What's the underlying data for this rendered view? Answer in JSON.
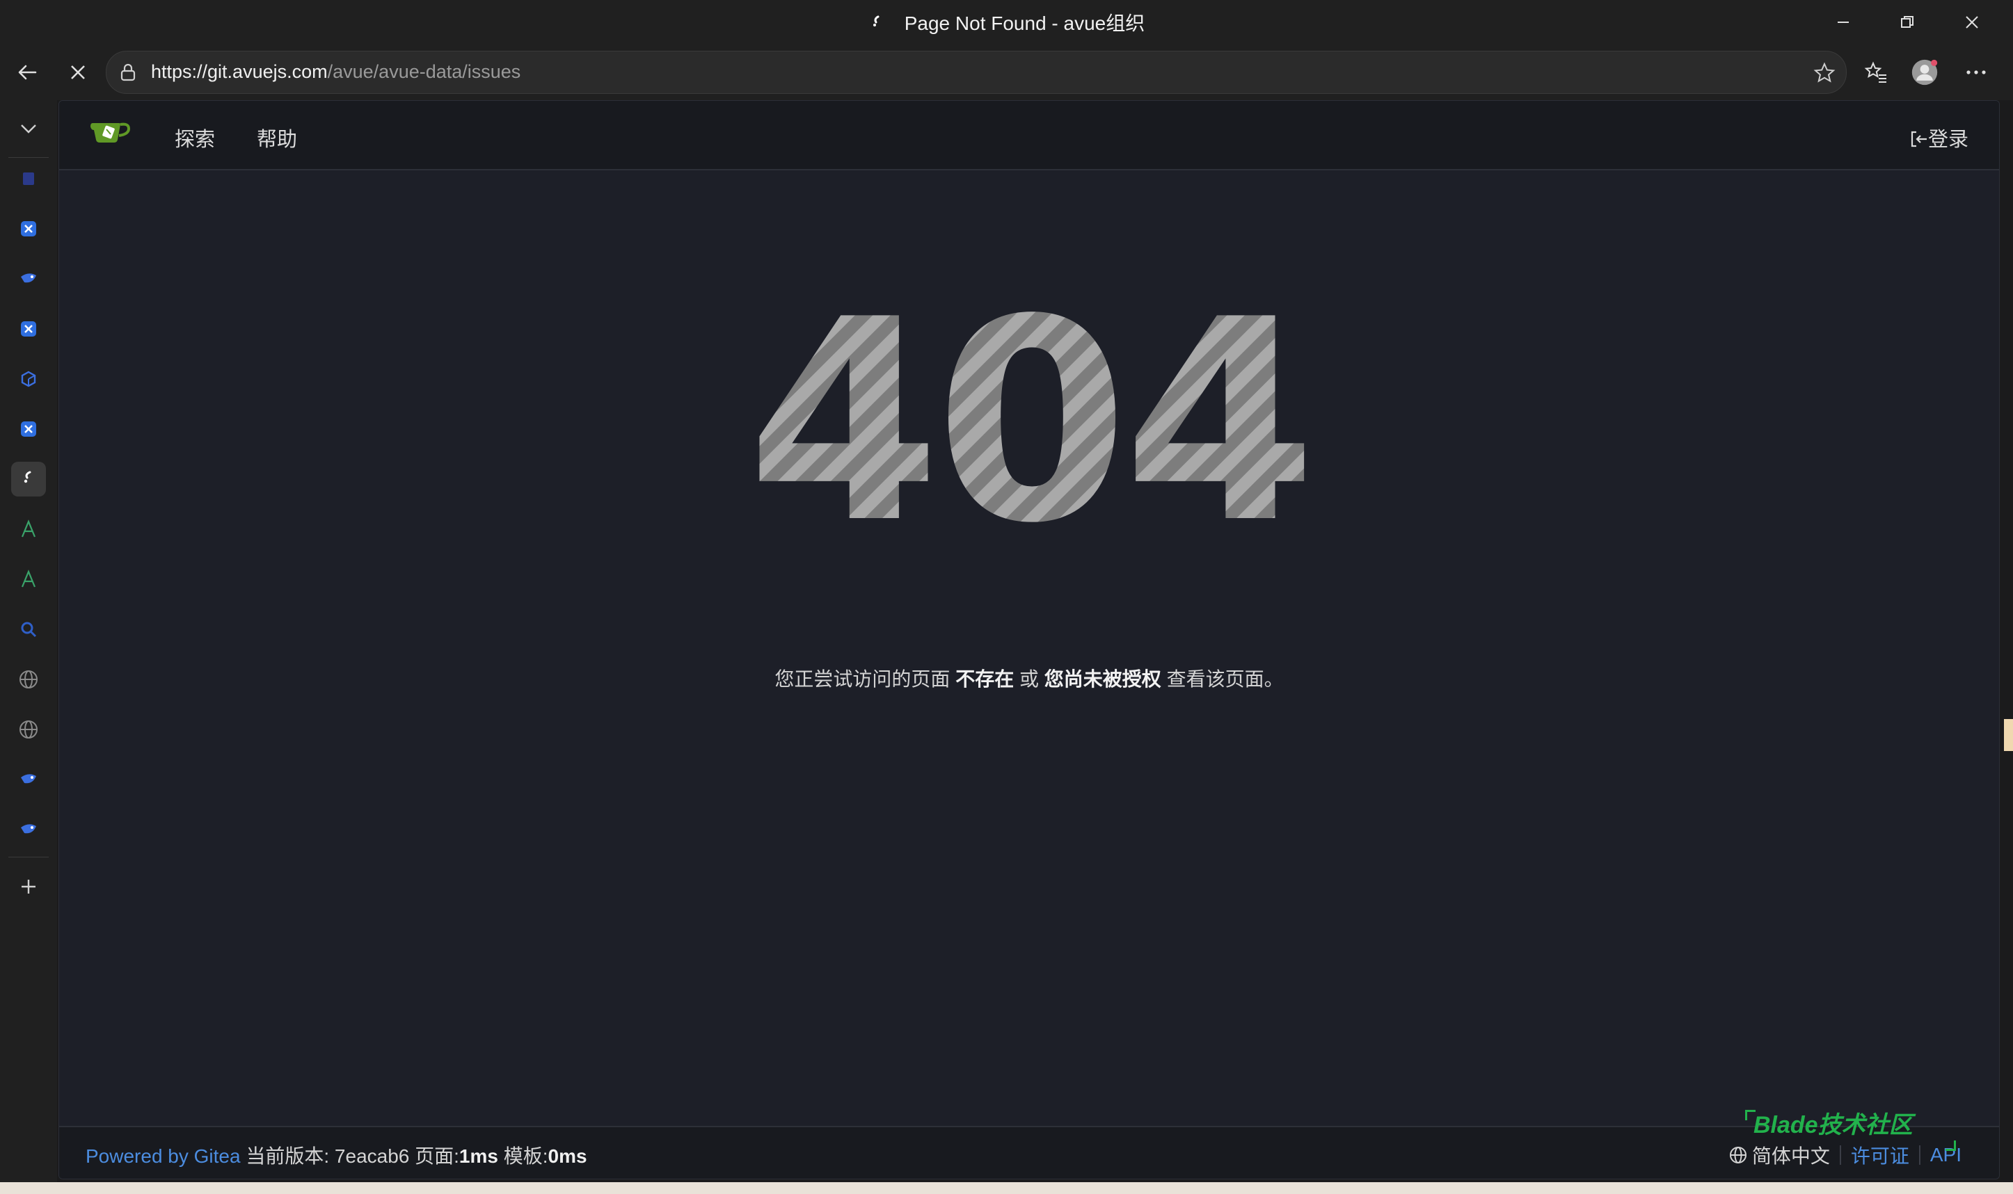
{
  "window": {
    "title": "Page Not Found - avue组织"
  },
  "browser": {
    "url_host": "https://git.avuejs.com",
    "url_path": "/avue/avue-data/issues"
  },
  "siderail": {
    "items": [
      {
        "name": "tab-1",
        "icon": "doc-icon",
        "color": "#3b5bd9"
      },
      {
        "name": "tab-2",
        "icon": "app-icon",
        "color": "#2f6fe0"
      },
      {
        "name": "tab-3",
        "icon": "bird-icon",
        "color": "#3b6fe0"
      },
      {
        "name": "tab-4",
        "icon": "app-icon",
        "color": "#2f6fe0"
      },
      {
        "name": "tab-5",
        "icon": "cube-icon",
        "color": "#3b6fe0"
      },
      {
        "name": "tab-6",
        "icon": "app-icon",
        "color": "#2f6fe0"
      },
      {
        "name": "tab-7",
        "icon": "gitea-favicon-icon",
        "color": "#ffffff"
      },
      {
        "name": "tab-8",
        "icon": "letter-a-icon",
        "color": "#3aa46a"
      },
      {
        "name": "tab-9",
        "icon": "letter-a-icon",
        "color": "#3aa46a"
      },
      {
        "name": "tab-10",
        "icon": "search-icon",
        "color": "#3b6fe0"
      },
      {
        "name": "tab-11",
        "icon": "globe-icon",
        "color": "#8a8a8a"
      },
      {
        "name": "tab-12",
        "icon": "globe-icon",
        "color": "#8a8a8a"
      },
      {
        "name": "tab-13",
        "icon": "bird-icon",
        "color": "#3b6fe0"
      },
      {
        "name": "tab-14",
        "icon": "bird-icon",
        "color": "#3b6fe0"
      }
    ]
  },
  "navbar": {
    "explore": "探索",
    "help": "帮助",
    "login": "登录"
  },
  "error": {
    "code": "404",
    "msg_prefix": "您正尝试访问的页面",
    "msg_bold1": "不存在",
    "msg_or": "或",
    "msg_bold2": "您尚未被授权",
    "msg_suffix": "查看该页面。"
  },
  "footer": {
    "powered": "Powered by Gitea",
    "version_label": "当前版本:",
    "version": "7eacab6",
    "page_label": "页面:",
    "page_time": "1ms",
    "template_label": "模板:",
    "template_time": "0ms",
    "language": "简体中文",
    "license": "许可证",
    "api": "API"
  },
  "watermark": {
    "text": "Blade技术社区"
  },
  "colors": {
    "accent_link": "#4c8de0",
    "gitea_green": "#609926",
    "watermark_green": "#22b24c"
  }
}
